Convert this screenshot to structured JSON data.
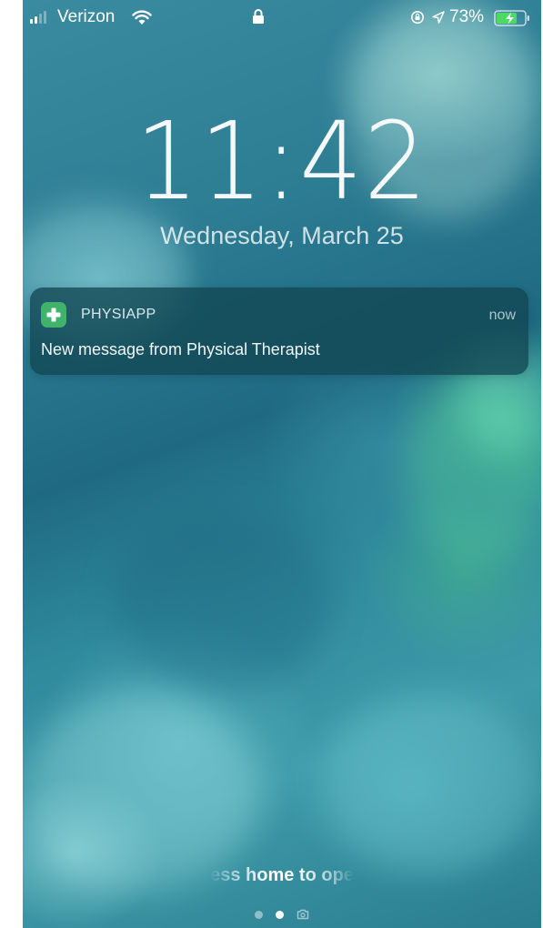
{
  "status_bar": {
    "carrier": "Verizon",
    "battery_percent": "73%",
    "icons": [
      "signal-icon",
      "wifi-icon",
      "lock-icon",
      "rotation-lock-icon",
      "location-icon",
      "battery-charging-icon"
    ]
  },
  "lock_screen": {
    "time": "11:42",
    "date": "Wednesday, March 25"
  },
  "notification": {
    "app_name": "PHYSIAPP",
    "time": "now",
    "message": "New message from Physical Therapist",
    "icon": "medical-cross-icon",
    "icon_color": "#3fb36a"
  },
  "bottom": {
    "hint": "ess home to ope",
    "page_count": 3,
    "active_page": 1
  },
  "colors": {
    "battery_fill": "#4cd964",
    "notification_bg": "#12465299"
  }
}
